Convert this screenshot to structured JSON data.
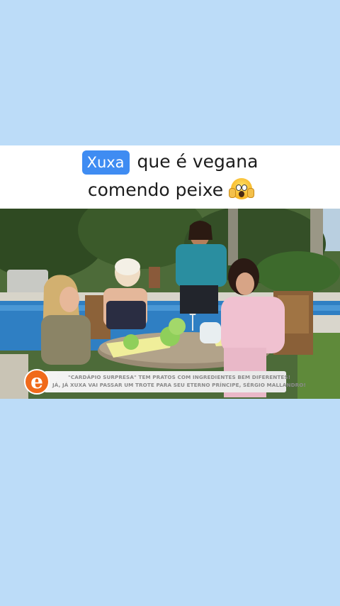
{
  "caption": {
    "highlight": "Xuxa",
    "line1_rest": "que é vegana",
    "line2": "comendo peixe",
    "emoji": "face-screaming-in-fear-icon"
  },
  "video": {
    "logo_letter": "e",
    "ticker_line1": "\"CARDÁPIO SURPRESA\" TEM PRATOS COM INGREDIENTES BEM DIFERENTES!",
    "ticker_line2": "JÁ, JÁ XUXA VAI PASSAR UM TROTE PARA SEU ETERNO PRÍNCIPE, SÉRGIO MALLANDRO!"
  },
  "colors": {
    "background": "#bcdcf8",
    "highlight": "#3f8cf2",
    "logo": "#f06a1a"
  }
}
